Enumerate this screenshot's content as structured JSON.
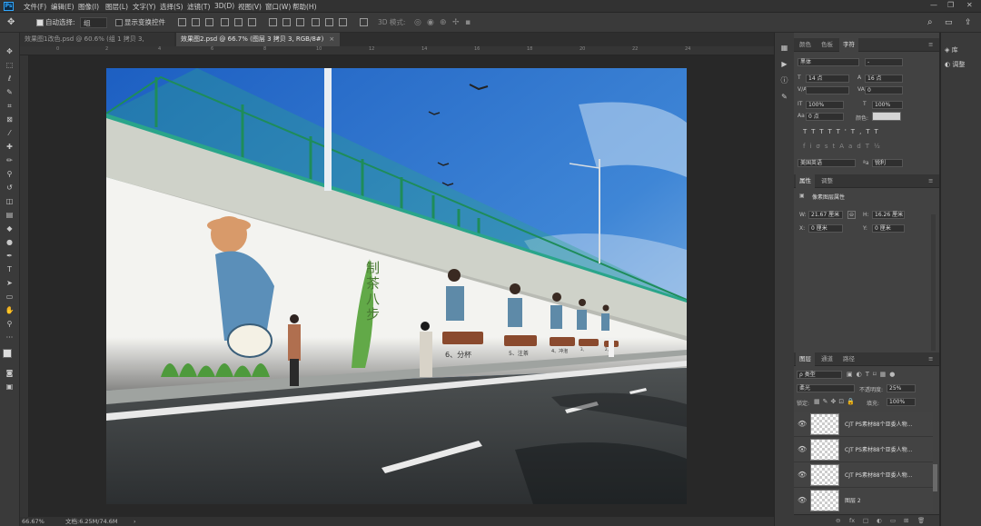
{
  "menubar": {
    "app_icon": "Ps",
    "items": [
      "文件(F)",
      "编辑(E)",
      "图像(I)",
      "图层(L)",
      "文字(Y)",
      "选择(S)",
      "滤镜(T)",
      "3D(D)",
      "视图(V)",
      "窗口(W)",
      "帮助(H)"
    ],
    "window_controls": [
      "—",
      "❐",
      "✕"
    ]
  },
  "options": {
    "auto_select_label": "自动选择:",
    "auto_select_value": "组",
    "show_transform_label": "显示变换控件",
    "mode_3d": "3D 模式:"
  },
  "tabs": [
    {
      "label": "效果图1改色.psd @ 60.6% (组 1 拷贝 3, RGB/8#)",
      "close": "×",
      "active": false
    },
    {
      "label": "效果图2.psd @ 66.7% (图层 3 拷贝 3, RGB/8#)",
      "close": "×",
      "active": true
    }
  ],
  "ruler_ticks": [
    "0",
    "2",
    "4",
    "6",
    "8",
    "10",
    "12",
    "14",
    "16",
    "18",
    "20",
    "22",
    "24"
  ],
  "status": {
    "zoom": "66.67%",
    "doc": "文档:6.25M/74.6M",
    "arrow": "›"
  },
  "char_panel": {
    "tabs": [
      "颜色",
      "色板",
      "字符"
    ],
    "font": "黑体",
    "style": "-",
    "size": "14 点",
    "leading": "16 点",
    "kerning": "",
    "tracking": "0",
    "vscale": "100%",
    "hscale": "100%",
    "baseline": "0 点",
    "color_label": "颜色:",
    "lang": "美国英语",
    "aa": "锐利"
  },
  "props_panel": {
    "tabs": [
      "属性",
      "调整"
    ],
    "title": "像素图层属性",
    "W_label": "W:",
    "W": "21.67 厘米",
    "H_label": "H:",
    "H": "16.26 厘米",
    "X_label": "X:",
    "X": "0 厘米",
    "Y_label": "Y:",
    "Y": "0 厘米",
    "link_icon": "⊖"
  },
  "layers_panel": {
    "tabs": [
      "图层",
      "通道",
      "路径"
    ],
    "filter": "ρ 类型",
    "blend": "柔光",
    "opacity_label": "不透明度:",
    "opacity": "25%",
    "lock_label": "锁定:",
    "fill_label": "填充:",
    "fill": "100%",
    "layers": [
      {
        "name": "CJT PS素材88个亚委人物...",
        "visible": "👁"
      },
      {
        "name": "CJT PS素材88个亚委人物...",
        "visible": "👁"
      },
      {
        "name": "CJT PS素材88个亚委人物...",
        "visible": "👁"
      },
      {
        "name": "图层 2",
        "visible": "👁"
      }
    ],
    "footer": [
      "⊖",
      "fx",
      "□",
      "◐",
      "▭",
      "⊞",
      "🗑"
    ]
  },
  "far_panel": {
    "items": [
      "库",
      "调整"
    ]
  },
  "scene": {
    "mural_title": [
      "制",
      "茶",
      "八",
      "步"
    ],
    "captions": [
      "6、分杯",
      "5、注茶",
      "4、冲泡",
      "3、",
      "2、"
    ]
  }
}
